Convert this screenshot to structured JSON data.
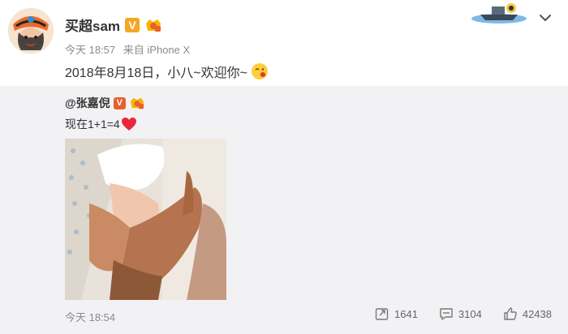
{
  "post": {
    "author": "买超sam",
    "verified_mark": "V",
    "time": "今天 18:57",
    "source": "来自 iPhone X",
    "text": "2018年8月18日，小八~欢迎你~",
    "icons": {
      "avatar": "pirate-avatar",
      "level": "level-badge-icon",
      "emoji": "kiss-emoji",
      "more": "chevron-down-icon",
      "decoration": "boat-icon"
    }
  },
  "repost": {
    "author": "@张嘉倪",
    "verified_mark": "V",
    "text": "现在1+1=4",
    "time": "今天 18:54",
    "stats": {
      "reposts": "1641",
      "comments": "3104",
      "likes": "42438"
    },
    "icons": {
      "heart": "heart-emoji",
      "photo": "baby-hands-photo",
      "repost": "repost-icon",
      "comment": "comment-icon",
      "like": "thumbs-up-icon"
    }
  },
  "colors": {
    "repost_bg": "#f2f2f5",
    "text": "#333333",
    "muted": "#8b8b8b",
    "verified_gold": "#f5a623",
    "verified_orange": "#e8602c"
  }
}
